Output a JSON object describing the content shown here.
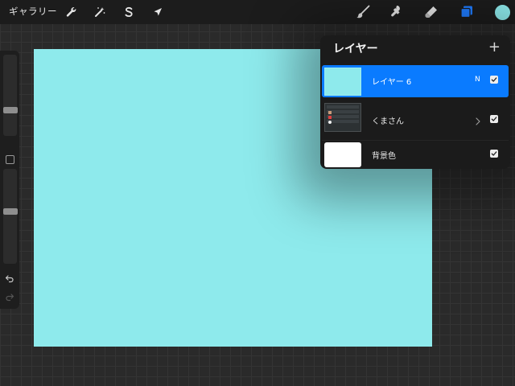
{
  "toolbar": {
    "gallery_label": "ギャラリー",
    "left_tools": [
      {
        "icon": "wrench-icon",
        "name": "actions"
      },
      {
        "icon": "magic-wand-icon",
        "name": "adjustments"
      },
      {
        "icon": "selection-s-icon",
        "name": "selection"
      },
      {
        "icon": "arrow-cursor-icon",
        "name": "transform"
      }
    ],
    "right_tools": [
      {
        "icon": "brush-icon",
        "name": "paint"
      },
      {
        "icon": "smudge-icon",
        "name": "smudge"
      },
      {
        "icon": "eraser-icon",
        "name": "erase"
      },
      {
        "icon": "layers-icon",
        "name": "layers",
        "active": true
      }
    ],
    "active_color": "#8eeaec",
    "active_tool_color": "#1f7cff"
  },
  "canvas": {
    "background_color": "#8eeaec"
  },
  "layers_panel": {
    "title": "レイヤー",
    "add_symbol": "+",
    "layers": [
      {
        "name": "レイヤー 6",
        "blend_mode": "N",
        "visible": true,
        "selected": true,
        "thumb_color": "#8eeaec"
      },
      {
        "name": "くまさん",
        "group": true,
        "visible": true,
        "selected": false,
        "thumb_color": "#2c3133"
      },
      {
        "name": "背景色",
        "visible": true,
        "selected": false,
        "thumb_color": "#ffffff"
      }
    ]
  },
  "sidebar": {
    "brush_size_level": 0.3,
    "opacity_level": 0.55
  }
}
